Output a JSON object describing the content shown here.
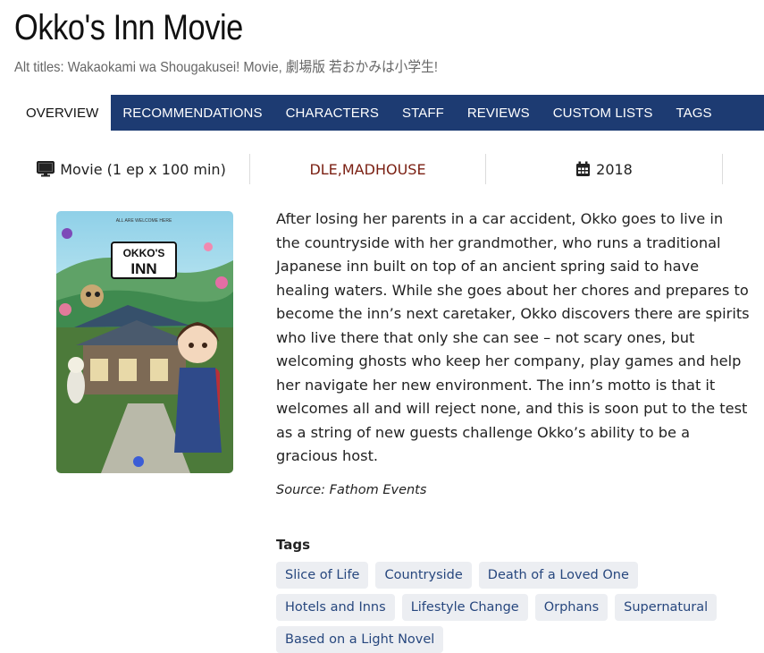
{
  "header": {
    "title": "Okko's Inn Movie",
    "alt_titles_label": "Alt titles:",
    "alt_titles_value": "Wakaokami wa Shougakusei! Movie, 劇場版 若おかみは小学生!"
  },
  "nav": {
    "tabs": [
      {
        "label": "OVERVIEW",
        "active": true
      },
      {
        "label": "RECOMMENDATIONS"
      },
      {
        "label": "CHARACTERS"
      },
      {
        "label": "STAFF"
      },
      {
        "label": "REVIEWS"
      },
      {
        "label": "CUSTOM LISTS"
      },
      {
        "label": "TAGS"
      }
    ]
  },
  "info": {
    "type_icon": "monitor-icon",
    "type": "Movie (1 ep x 100 min)",
    "studios": [
      "DLE",
      "MADHOUSE"
    ],
    "studio_separator": ", ",
    "year_icon": "calendar-icon",
    "year": "2018"
  },
  "poster": {
    "tagline": "ALL ARE WELCOME HERE",
    "logo_line1": "OKKO'S",
    "logo_line2": "INN"
  },
  "synopsis": "After losing her parents in a car accident, Okko goes to live in the countryside with her grandmother, who runs a traditional Japanese inn built on top of an ancient spring said to have healing waters. While she goes about her chores and prepares to become the inn’s next caretaker, Okko discovers there are spirits who live there that only she can see – not scary ones, but welcoming ghosts who keep her company, play games and help her navigate her new environment. The inn’s motto is that it welcomes all and will reject none, and this is soon put to the test as a string of new guests challenge Okko’s ability to be a gracious host.",
  "source": "Source: Fathom Events",
  "tags": {
    "heading": "Tags",
    "items": [
      "Slice of Life",
      "Countryside",
      "Death of a Loved One",
      "Hotels and Inns",
      "Lifestyle Change",
      "Orphans",
      "Supernatural",
      "Based on a Light Novel"
    ]
  },
  "colors": {
    "nav_bg": "#1d3b72",
    "studio_link": "#7a1f12",
    "tag_bg": "#eceef2",
    "tag_text": "#27477e"
  }
}
